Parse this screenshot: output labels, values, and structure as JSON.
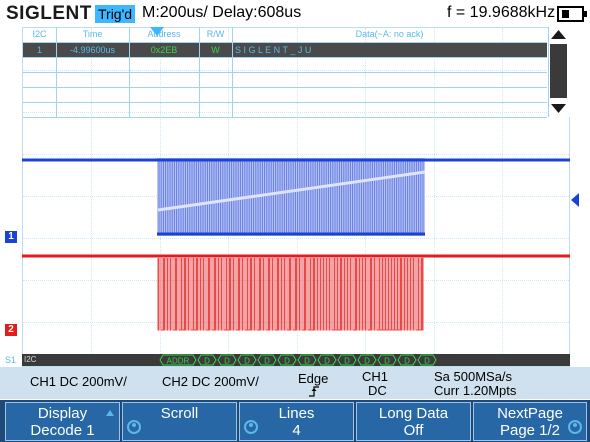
{
  "header": {
    "brand": "SIGLENT",
    "trigger_status": "Trig'd",
    "timebase": "M:200us/ Delay:608us",
    "frequency": "f = 19.9688kHz"
  },
  "decode_table": {
    "columns": [
      "I2C",
      "Time",
      "Address",
      "R/W",
      "Data(~A: no ack)"
    ],
    "rows": [
      {
        "index": "1",
        "time": "-4.99600us",
        "address": "0x2EB",
        "rw": "W",
        "data": "S I G L E N T _ J U"
      }
    ]
  },
  "channels": {
    "ch1_marker": "1",
    "ch2_marker": "2",
    "ch1_color": "#1a43d6",
    "ch2_color": "#e21b1b"
  },
  "bus": {
    "label": "I2C",
    "side_label": "S1",
    "first_packet": "ADDR",
    "data_packets": [
      "D",
      "D",
      "D",
      "D",
      "D",
      "D",
      "D",
      "D",
      "D",
      "D",
      "D",
      "D"
    ]
  },
  "status_bar": {
    "ch1": "CH1 DC 200mV/",
    "ch2": "CH2 DC 200mV/",
    "trigger_type": "Edge",
    "trigger_source": "CH1",
    "trigger_coupling": "DC",
    "sample_rate": "Sa 500MSa/s",
    "memory_depth": "Curr 1.20Mpts"
  },
  "softkeys": [
    {
      "line1": "Display",
      "line2": "Decode 1"
    },
    {
      "line1": "Scroll",
      "line2": ""
    },
    {
      "line1": "Lines",
      "line2": "4"
    },
    {
      "line1": "Long Data",
      "line2": "Off"
    },
    {
      "line1": "NextPage",
      "line2": "Page 1/2"
    }
  ],
  "icons": {
    "battery": "battery-icon",
    "trigger_position": "trigger-position-icon",
    "trigger_level": "trigger-level-icon",
    "scroll_up": "arrow-up-icon",
    "scroll_down": "arrow-down-icon",
    "knob": "knob-icon"
  }
}
